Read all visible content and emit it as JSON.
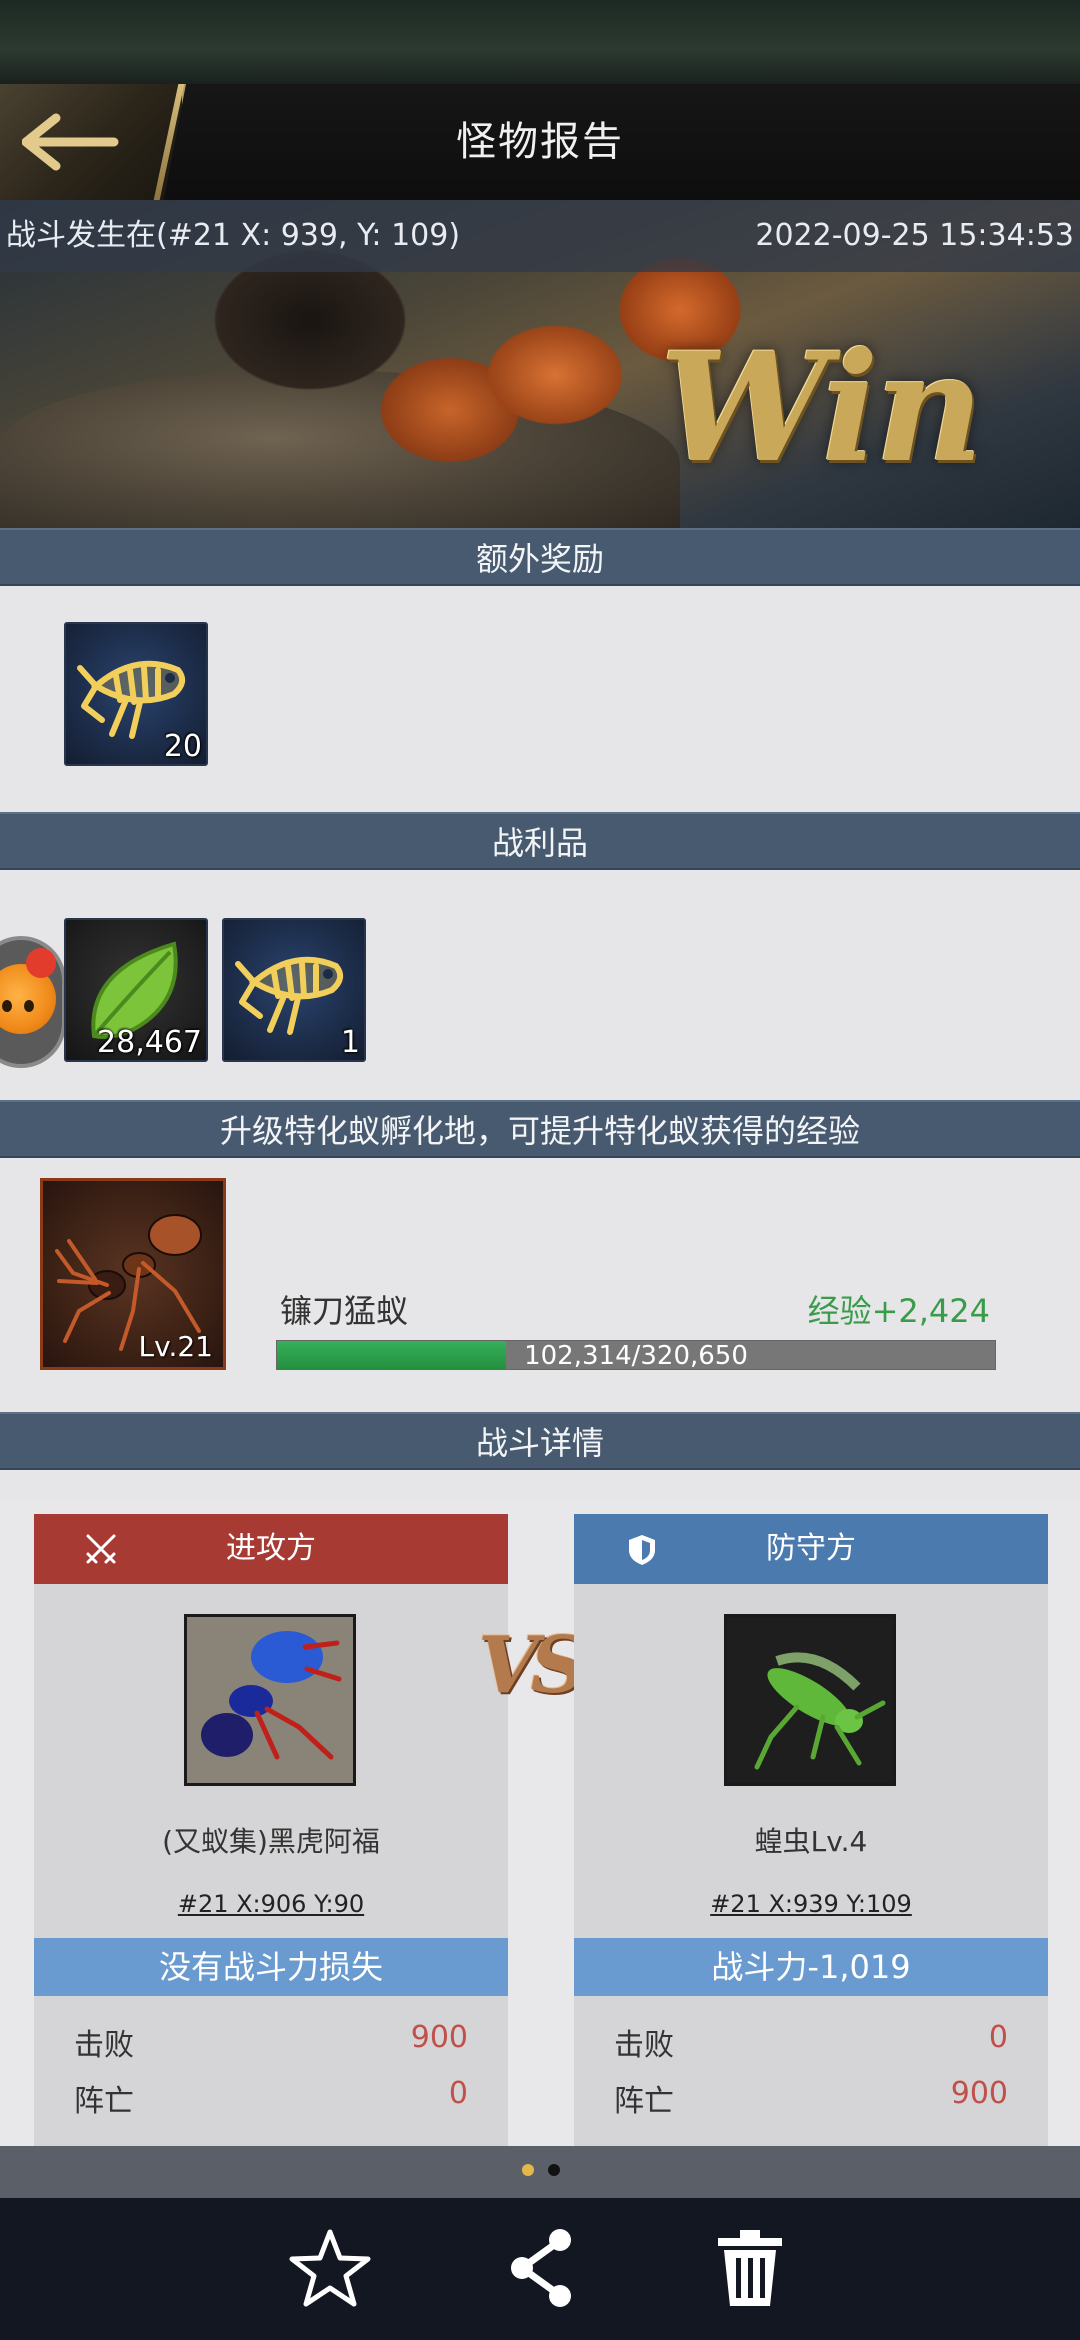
{
  "header": {
    "title": "怪物报告",
    "back_icon": "arrow-left-icon"
  },
  "banner": {
    "location": "战斗发生在(#21 X: 939, Y: 109)",
    "datetime": "2022-09-25 15:34:53",
    "result_text": "Win"
  },
  "bonus": {
    "title": "额外奖励",
    "items": [
      {
        "icon": "fish-skeleton-icon",
        "qty": "20"
      }
    ]
  },
  "loot": {
    "title": "战利品",
    "items": [
      {
        "icon": "leaf-icon",
        "qty": "28,467"
      },
      {
        "icon": "fish-skeleton-icon",
        "qty": "1"
      }
    ]
  },
  "special_ant": {
    "title": "升级特化蚁孵化地，可提升特化蚁获得的经验",
    "name": "镰刀猛蚁",
    "level": "Lv.21",
    "exp_gain": "经验+2,424",
    "exp_text": "102,314/320,650",
    "exp_current": 102314,
    "exp_max": 320650,
    "bar_color": "#2f9f4f"
  },
  "battle": {
    "title": "战斗详情",
    "vs_text": "VS",
    "attacker": {
      "side_label": "进攻方",
      "icon": "crossed-swords-icon",
      "name": "(又蚁集)黑虎阿福",
      "coords": "#21  X:906  Y:90",
      "loss_text": "没有战斗力损失",
      "stats": [
        {
          "label": "击败",
          "value": "900"
        },
        {
          "label": "阵亡",
          "value": "0"
        }
      ],
      "color": "#a83a34"
    },
    "defender": {
      "side_label": "防守方",
      "icon": "shield-icon",
      "name": "蝗虫Lv.4",
      "coords": "#21  X:939  Y:109",
      "loss_text": "战斗力-1,019",
      "stats": [
        {
          "label": "击败",
          "value": "0"
        },
        {
          "label": "阵亡",
          "value": "900"
        }
      ],
      "color": "#4a7aae"
    }
  },
  "pager": {
    "pages": 2,
    "current": 1
  },
  "bottom_bar": {
    "buttons": [
      {
        "name": "favorite",
        "icon": "star-icon"
      },
      {
        "name": "share",
        "icon": "share-icon"
      },
      {
        "name": "delete",
        "icon": "trash-icon"
      }
    ]
  }
}
